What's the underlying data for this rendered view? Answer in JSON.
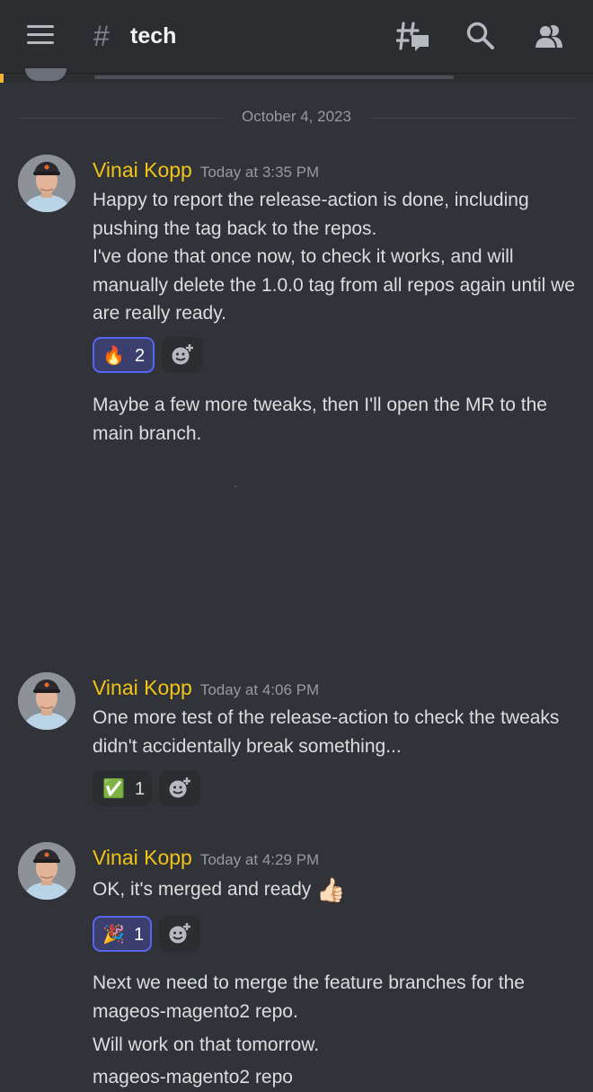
{
  "header": {
    "channel_hash": "#",
    "channel_name": "tech",
    "icons": [
      "menu-icon",
      "threads-icon",
      "search-icon",
      "members-icon"
    ]
  },
  "date_divider": "October 4, 2023",
  "messages": [
    {
      "author": "Vinai Kopp",
      "timestamp": "Today at 3:35 PM",
      "paragraphs": [
        "Happy to report the release-action is done, including pushing the tag back to the repos.",
        "I've done that once now, to check it works, and will manually delete the 1.0.0 tag from all repos again until we are really ready."
      ],
      "reactions": [
        {
          "emoji": "🔥",
          "icon": "fire-icon",
          "count": "2",
          "me": true
        }
      ],
      "follow_up": "Maybe a few more tweaks, then I'll open the MR to the main branch."
    },
    {
      "author": "Vinai Kopp",
      "timestamp": "Today at 4:06 PM",
      "paragraphs": [
        "One more test of the release-action to check the tweaks didn't accidentally break something..."
      ],
      "reactions": [
        {
          "emoji": "✅",
          "icon": "check-mark-icon",
          "count": "1",
          "me": false
        }
      ]
    },
    {
      "author": "Vinai Kopp",
      "timestamp": "Today at 4:29 PM",
      "paragraphs": [
        "OK, it's merged and ready"
      ],
      "inline_emoji": "👍🏻",
      "reactions": [
        {
          "emoji": "🎉",
          "icon": "party-popper-icon",
          "count": "1",
          "me": true
        }
      ],
      "follow_up": "Next we need to merge the feature branches for the mageos-magento2 repo.",
      "follow_up_2": "Will work on that tomorrow.",
      "follow_up_3": "mageos-magento2 repo"
    }
  ],
  "colors": {
    "background": "#313338",
    "header": "#2b2d31",
    "author": "#f0c419",
    "accent": "#5865f2",
    "muted": "#949ba4"
  }
}
